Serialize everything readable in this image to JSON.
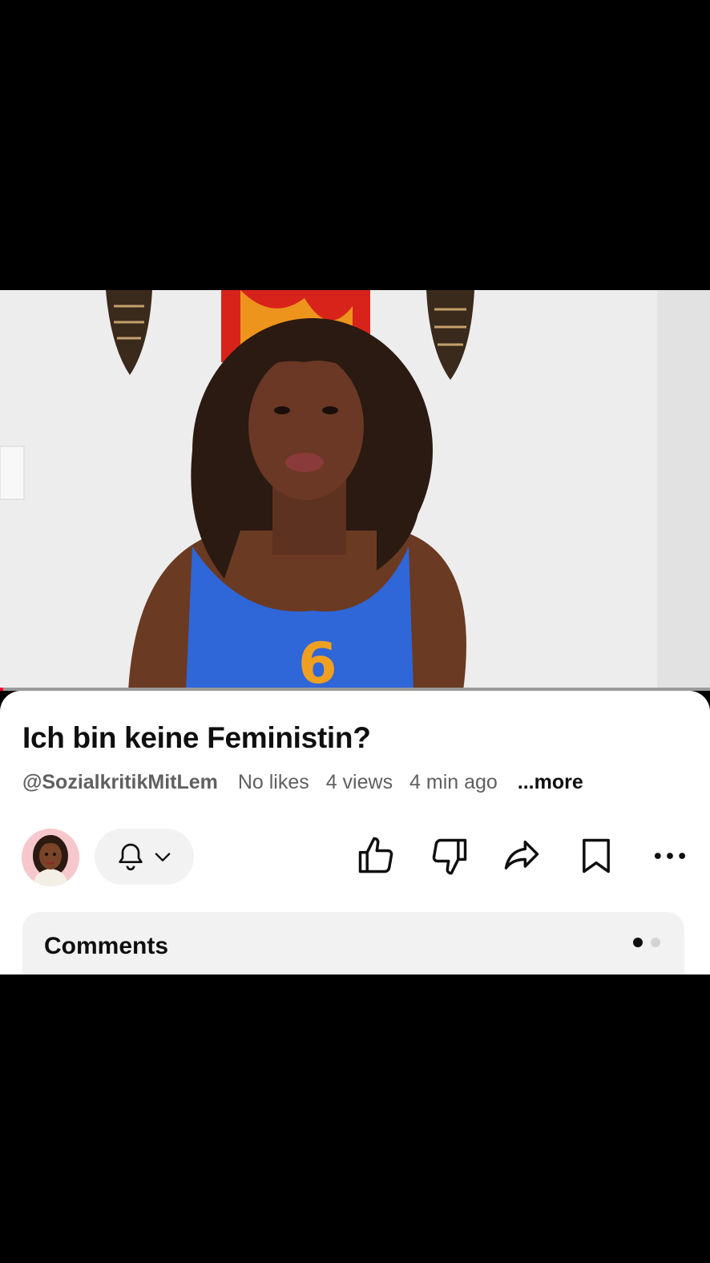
{
  "video": {
    "progress_fraction": 0.005
  },
  "info": {
    "title": "Ich bin keine Feministin?",
    "channel_handle": "@SozialkritikMitLem",
    "likes": "No likes",
    "views": "4 views",
    "time_ago": "4 min ago",
    "more_label": "...more"
  },
  "actions": {
    "icons": [
      "bell-icon",
      "chevron-down-icon",
      "thumbs-up-icon",
      "thumbs-down-icon",
      "share-icon",
      "bookmark-icon",
      "more-icon"
    ]
  },
  "comments": {
    "title": "Comments",
    "page_indicator": {
      "count": 2,
      "active": 0
    }
  },
  "colors": {
    "accent": "#ff0033",
    "text_primary": "#0f0f0f",
    "text_secondary": "#606060",
    "card_bg": "#f2f2f2"
  }
}
